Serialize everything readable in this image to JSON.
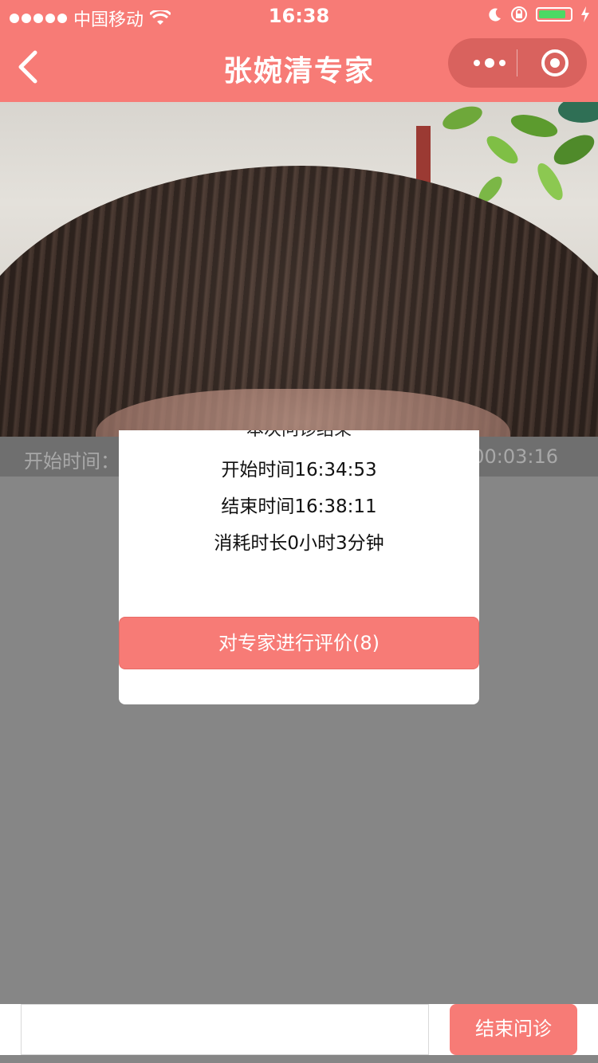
{
  "status_bar": {
    "carrier": "中国移动",
    "time": "16:38",
    "icons": [
      "signal-dots-icon",
      "wifi-icon",
      "moon-icon",
      "orientation-lock-icon",
      "battery-icon",
      "charging-icon"
    ]
  },
  "nav": {
    "title": "张婉清专家",
    "icons": [
      "back-chevron-icon",
      "more-dots-icon",
      "close-target-icon"
    ]
  },
  "info_bar": {
    "start_label": "开始时间：",
    "duration_value": "00:03:16"
  },
  "modal": {
    "header_partial": "本次问诊结束",
    "start_time": "开始时间16:34:53",
    "end_time": "结束时间16:38:11",
    "duration": "消耗时长0小时3分钟",
    "rate_button": "对专家进行评价(8)"
  },
  "bottom": {
    "input_value": "",
    "end_button": "结束问诊"
  },
  "colors": {
    "accent": "#F77B76",
    "overlay": "#868686"
  }
}
